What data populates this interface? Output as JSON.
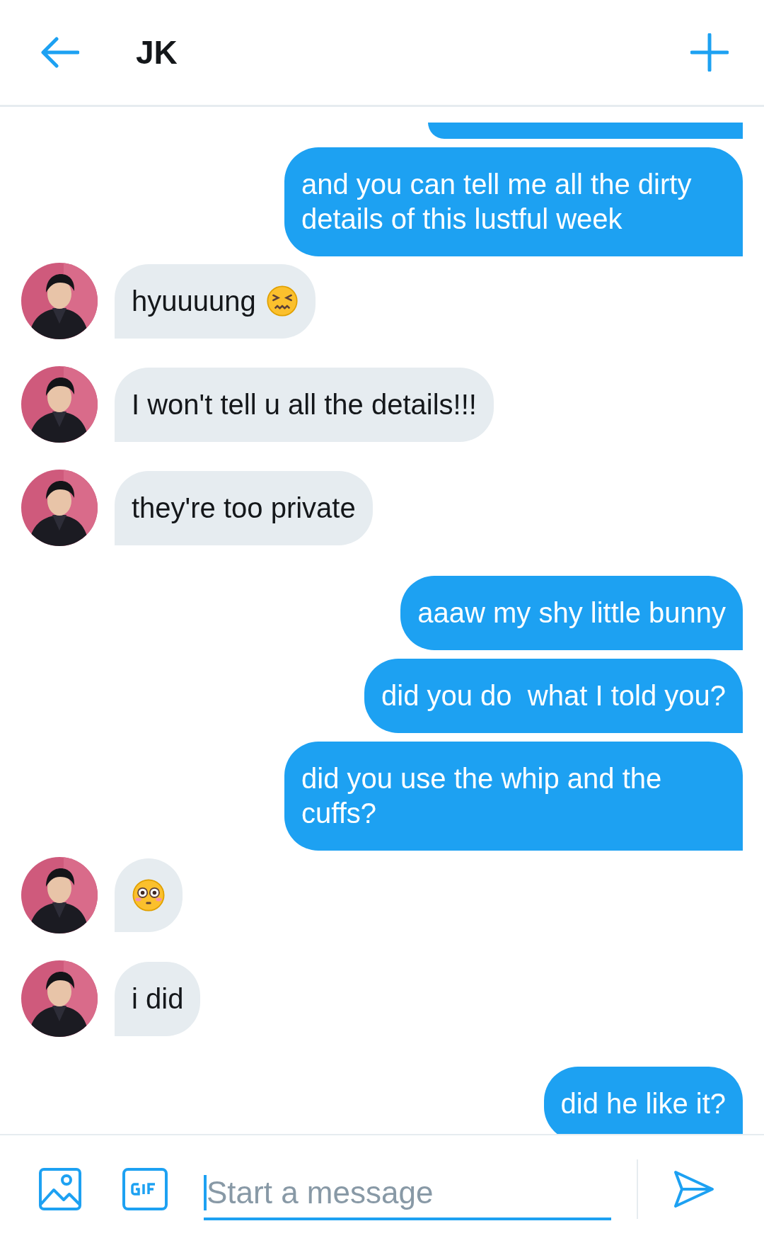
{
  "header": {
    "title": "JK"
  },
  "messages": [
    {
      "outgoing": true,
      "clipped": true
    },
    {
      "outgoing": true,
      "text": "and you can tell me all the dirty details of this lustful week"
    },
    {
      "outgoing": false,
      "text": "hyuuuung",
      "emoji": {
        "kind": "confounded"
      }
    },
    {
      "outgoing": false,
      "text": "I won't tell u all the details!!!"
    },
    {
      "outgoing": false,
      "text": "they're too private"
    },
    {
      "outgoing": true,
      "text": "aaaw my shy little bunny"
    },
    {
      "outgoing": true,
      "text": "did you do  what I told you?"
    },
    {
      "outgoing": true,
      "text": "did you use the whip and the cuffs?"
    },
    {
      "outgoing": false,
      "emoji": {
        "kind": "flushed"
      }
    },
    {
      "outgoing": false,
      "text": "i did"
    },
    {
      "outgoing": true,
      "text": "did he like it?"
    }
  ],
  "composer": {
    "placeholder": "Start a message"
  }
}
